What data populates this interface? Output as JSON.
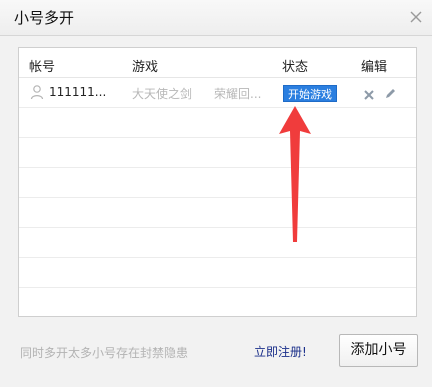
{
  "window": {
    "title": "小号多开"
  },
  "table": {
    "headers": {
      "account": "帐号",
      "game": "游戏",
      "status": "状态",
      "edit": "编辑"
    },
    "rows": [
      {
        "account": "111111...",
        "game": "大天使之剑",
        "server": "荣耀回...",
        "action": "开始游戏"
      }
    ],
    "empty_rows": 7
  },
  "footer": {
    "warning": "同时多开太多小号存在封禁隐患",
    "register": "立即注册!",
    "add_button": "添加小号"
  },
  "colors": {
    "accent": "#2b7fe0",
    "link": "#1a2f8a",
    "arrow": "#f03c3c"
  },
  "icons": {
    "close": "close-icon",
    "user": "user-icon",
    "delete": "delete-icon",
    "edit": "pencil-icon"
  }
}
